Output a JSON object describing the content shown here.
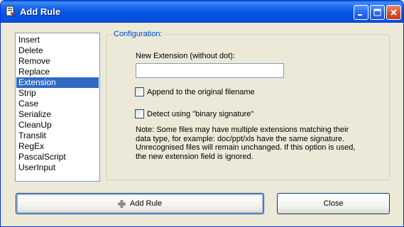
{
  "window": {
    "title": "Add Rule"
  },
  "rules_list": {
    "items": [
      "Insert",
      "Delete",
      "Remove",
      "Replace",
      "Extension",
      "Strip",
      "Case",
      "Serialize",
      "CleanUp",
      "Translit",
      "RegEx",
      "PascalScript",
      "UserInput"
    ],
    "selected": "Extension"
  },
  "config": {
    "group_label": "Configuration:",
    "new_extension_label": "New Extension (without dot):",
    "new_extension_value": "",
    "append_label": "Append to the original filename",
    "append_checked": false,
    "detect_label": "Detect using \"binary signature\"",
    "detect_checked": false,
    "note_lines": [
      "Note: Some files may have multiple extensions matching their",
      "data type, for example: doc/ppt/xls have the same signature.",
      "Unrecognised files will remain unchanged. If this option is used,",
      "the new extension field is ignored."
    ]
  },
  "buttons": {
    "add_rule": "Add Rule",
    "close": "Close"
  },
  "icons": {
    "app": "rename-app-icon",
    "minimize": "minimize-icon",
    "maximize": "maximize-icon",
    "close": "close-icon",
    "add": "plus-icon"
  },
  "colors": {
    "titlebar": "#0055e5",
    "selection": "#316ac5",
    "group_label": "#0046d5",
    "face": "#ece9d8"
  }
}
